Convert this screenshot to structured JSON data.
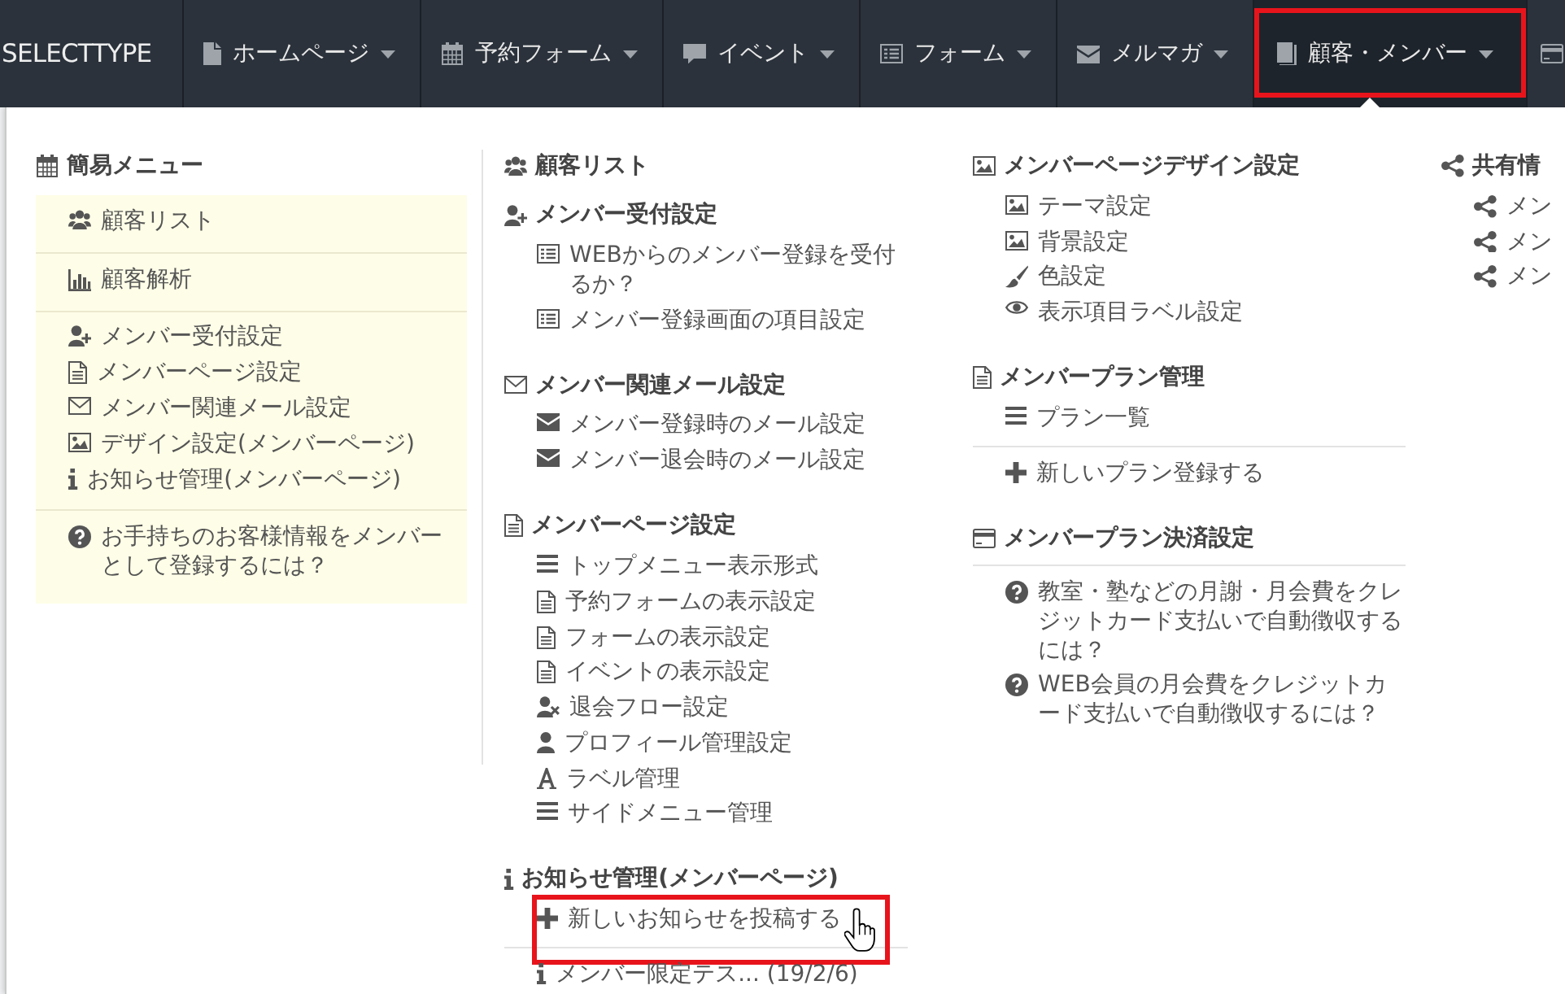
{
  "nav": {
    "logo": "SELECTTYPE",
    "items": [
      {
        "kind": "file",
        "label": "ホームページ",
        "selected": false,
        "highlighted": false
      },
      {
        "kind": "calendar",
        "label": "予約フォーム",
        "selected": false,
        "highlighted": false
      },
      {
        "kind": "speech",
        "label": "イベント",
        "selected": false,
        "highlighted": false
      },
      {
        "kind": "form",
        "label": "フォーム",
        "selected": false,
        "highlighted": false
      },
      {
        "kind": "mail-solid",
        "label": "メルマガ",
        "selected": false,
        "highlighted": false
      },
      {
        "kind": "book",
        "label": "顧客・メンバー",
        "selected": true,
        "highlighted": true
      },
      {
        "kind": "card",
        "selected": false,
        "highlighted": false
      }
    ]
  },
  "menu": {
    "columns": [
      {
        "kind": "quick",
        "heading": {
          "kind": "calendar",
          "label": "簡易メニュー"
        },
        "sections": [
          {
            "items": [
              {
                "kind": "users",
                "label": "顧客リスト"
              }
            ]
          },
          {
            "items": [
              {
                "kind": "chart",
                "label": "顧客解析"
              }
            ]
          },
          {
            "items": [
              {
                "kind": "user-plus",
                "label": "メンバー受付設定"
              },
              {
                "kind": "document",
                "label": "メンバーページ設定"
              },
              {
                "kind": "mail",
                "label": "メンバー関連メール設定"
              },
              {
                "kind": "image",
                "label": "デザイン設定(メンバーページ)"
              },
              {
                "kind": "info",
                "label": "お知らせ管理(メンバーページ)"
              }
            ]
          },
          {
            "items": [
              {
                "kind": "help",
                "label": "お手持ちのお客様情報をメンバーとして登録するには？"
              }
            ]
          }
        ]
      },
      {
        "kind": "groups",
        "groups": [
          {
            "heading": {
              "kind": "users",
              "label": "顧客リスト"
            }
          },
          {
            "heading": {
              "kind": "user-plus",
              "label": "メンバー受付設定"
            },
            "items": [
              {
                "kind": "form",
                "label": "WEBからのメンバー登録を受付るか？"
              },
              {
                "kind": "form",
                "label": "メンバー登録画面の項目設定"
              }
            ]
          },
          {
            "heading": {
              "kind": "mail",
              "label": "メンバー関連メール設定"
            },
            "items": [
              {
                "kind": "mail-solid",
                "label": "メンバー登録時のメール設定"
              },
              {
                "kind": "mail-solid",
                "label": "メンバー退会時のメール設定"
              }
            ]
          },
          {
            "heading": {
              "kind": "document",
              "label": "メンバーページ設定"
            },
            "items": [
              {
                "kind": "lines",
                "label": "トップメニュー表示形式"
              },
              {
                "kind": "document",
                "label": "予約フォームの表示設定"
              },
              {
                "kind": "document",
                "label": "フォームの表示設定"
              },
              {
                "kind": "document",
                "label": "イベントの表示設定"
              },
              {
                "kind": "user-x",
                "label": "退会フロー設定"
              },
              {
                "kind": "user",
                "label": "プロフィール管理設定"
              },
              {
                "kind": "font",
                "label": "ラベル管理"
              },
              {
                "kind": "lines",
                "label": "サイドメニュー管理"
              }
            ]
          },
          {
            "heading": {
              "kind": "info",
              "label": "お知らせ管理(メンバーページ)"
            },
            "items": [
              {
                "kind": "plus",
                "label": "新しいお知らせを投稿する",
                "highlighted": true,
                "hovered": true
              },
              {
                "kind": "divider"
              },
              {
                "kind": "info",
                "label": "メンバー限定テス... (19/2/6)",
                "highlighted": false,
                "hovered": false
              }
            ]
          }
        ]
      },
      {
        "kind": "groups",
        "groups": [
          {
            "heading": {
              "kind": "image",
              "label": "メンバーページデザイン設定"
            },
            "items": [
              {
                "kind": "image",
                "label": "テーマ設定"
              },
              {
                "kind": "image",
                "label": "背景設定"
              },
              {
                "kind": "brush",
                "label": "色設定"
              },
              {
                "kind": "eye",
                "label": "表示項目ラベル設定"
              }
            ]
          },
          {
            "heading": {
              "kind": "document",
              "label": "メンバープラン管理"
            },
            "items": [
              {
                "kind": "lines",
                "label": "プラン一覧"
              },
              {
                "kind": "divider"
              },
              {
                "kind": "plus",
                "label": "新しいプラン登録する"
              }
            ]
          },
          {
            "heading": {
              "kind": "card",
              "label": "メンバープラン決済設定"
            },
            "items": [
              {
                "kind": "divider"
              },
              {
                "kind": "help",
                "label": "教室・塾などの月謝・月会費をクレジットカード支払いで自動徴収するには？"
              },
              {
                "kind": "help",
                "label": "WEB会員の月会費をクレジットカード支払いで自動徴収するには？"
              }
            ]
          }
        ]
      },
      {
        "kind": "groups",
        "groups": [
          {
            "heading": {
              "kind": "share",
              "label": "共有情"
            },
            "items": [
              {
                "kind": "share",
                "label": "メン"
              },
              {
                "kind": "share",
                "label": "メン"
              },
              {
                "kind": "share",
                "label": "メン"
              }
            ]
          }
        ]
      }
    ]
  }
}
